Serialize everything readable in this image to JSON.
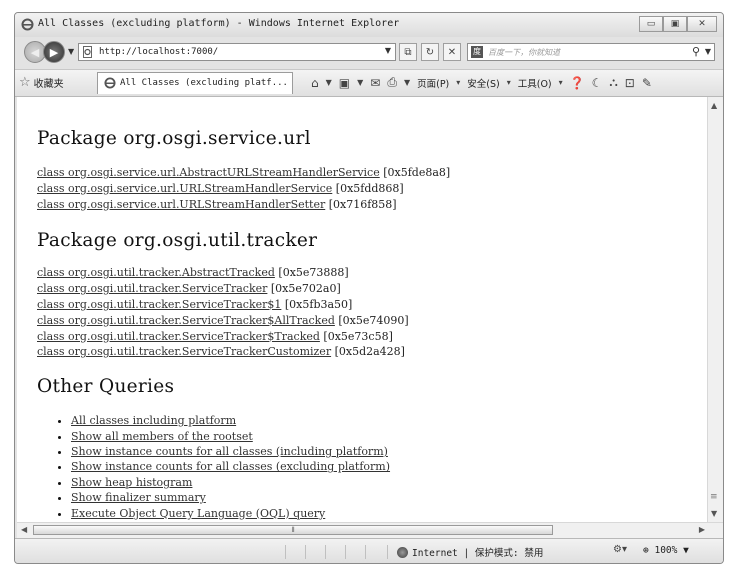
{
  "window": {
    "title": "All Classes (excluding platform) - Windows Internet Explorer",
    "minimize_label": "▭",
    "maximize_label": "▣",
    "close_label": "✕"
  },
  "address_bar": {
    "url": "http://localhost:7000/",
    "search_placeholder": "百度一下，你就知道"
  },
  "command_bar": {
    "favorites_label": "收藏夹",
    "tab_title": "All Classes (excluding platf...",
    "page_menu": "页面(P)",
    "safety_menu": "安全(S)",
    "tools_menu": "工具(O)"
  },
  "sections": [
    {
      "title": "Package org.osgi.service.url",
      "classes": [
        {
          "name": "class org.osgi.service.url.AbstractURLStreamHandlerService",
          "addr": "[0x5fde8a8]"
        },
        {
          "name": "class org.osgi.service.url.URLStreamHandlerService",
          "addr": "[0x5fdd868]"
        },
        {
          "name": "class org.osgi.service.url.URLStreamHandlerSetter",
          "addr": "[0x716f858]"
        }
      ]
    },
    {
      "title": "Package org.osgi.util.tracker",
      "classes": [
        {
          "name": "class org.osgi.util.tracker.AbstractTracked",
          "addr": "[0x5e73888]"
        },
        {
          "name": "class org.osgi.util.tracker.ServiceTracker",
          "addr": "[0x5e702a0]"
        },
        {
          "name": "class org.osgi.util.tracker.ServiceTracker$1",
          "addr": "[0x5fb3a50]"
        },
        {
          "name": "class org.osgi.util.tracker.ServiceTracker$AllTracked",
          "addr": "[0x5e74090]"
        },
        {
          "name": "class org.osgi.util.tracker.ServiceTracker$Tracked",
          "addr": "[0x5e73c58]"
        },
        {
          "name": "class org.osgi.util.tracker.ServiceTrackerCustomizer",
          "addr": "[0x5d2a428]"
        }
      ]
    }
  ],
  "other_queries": {
    "title": "Other Queries",
    "items": [
      "All classes including platform",
      "Show all members of the rootset",
      "Show instance counts for all classes (including platform)",
      "Show instance counts for all classes (excluding platform)",
      "Show heap histogram",
      "Show finalizer summary",
      "Execute Object Query Language (OQL) query"
    ]
  },
  "status_bar": {
    "zone": "Internet | 保护模式: 禁用",
    "zoom": "100%"
  }
}
